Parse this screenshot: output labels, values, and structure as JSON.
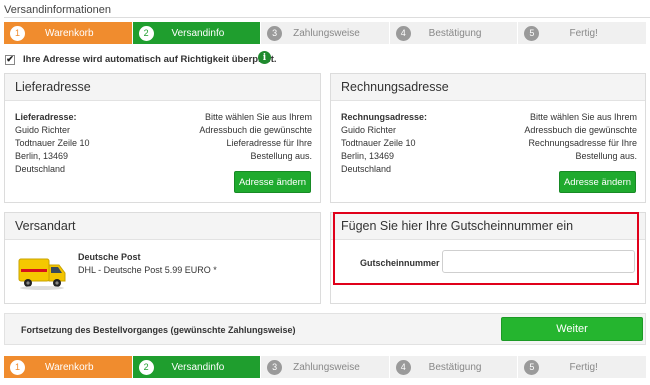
{
  "page_title": "Versandinformationen",
  "steps": [
    {
      "num": "1",
      "label": "Warenkorb",
      "state": "done",
      "color": "#f08c2e"
    },
    {
      "num": "2",
      "label": "Versandinfo",
      "state": "current",
      "color": "#1f9e2e"
    },
    {
      "num": "3",
      "label": "Zahlungsweise",
      "state": "pending"
    },
    {
      "num": "4",
      "label": "Bestätigung",
      "state": "pending"
    },
    {
      "num": "5",
      "label": "Fertig!",
      "state": "pending"
    }
  ],
  "address_check": {
    "checked": true,
    "label": "Ihre Adresse wird automatisch auf Richtigkeit überprüft.",
    "info_icon": "i"
  },
  "delivery": {
    "title": "Lieferadresse",
    "label": "Lieferadresse:",
    "lines": [
      "Guido Richter",
      "Todtnauer Zeile 10",
      "Berlin, 13469",
      "Deutschland"
    ],
    "note": "Bitte wählen Sie aus Ihrem Adressbuch die gewünschte Lieferadresse für Ihre Bestellung aus.",
    "button": "Adresse ändern"
  },
  "billing": {
    "title": "Rechnungsadresse",
    "label": "Rechnungsadresse:",
    "lines": [
      "Guido Richter",
      "Todtnauer Zeile 10",
      "Berlin, 13469",
      "Deutschland"
    ],
    "note": "Bitte wählen Sie aus Ihrem Adressbuch die gewünschte Rechnungsadresse für Ihre Bestellung aus.",
    "button": "Adresse ändern"
  },
  "shipping": {
    "title": "Versandart",
    "carrier": "Deutsche Post",
    "description": "DHL - Deutsche Post 5.99 EURO *"
  },
  "voucher": {
    "title": "Fügen Sie hier Ihre Gutscheinnummer ein",
    "label": "Gutscheinnummer",
    "value": ""
  },
  "continue": {
    "text": "Fortsetzung des Bestellvorganges (gewünschte Zahlungsweise)",
    "button": "Weiter"
  },
  "colors": {
    "accent_green": "#1faa2e",
    "step_orange": "#f08c2e",
    "highlight_red": "#e0001a"
  }
}
